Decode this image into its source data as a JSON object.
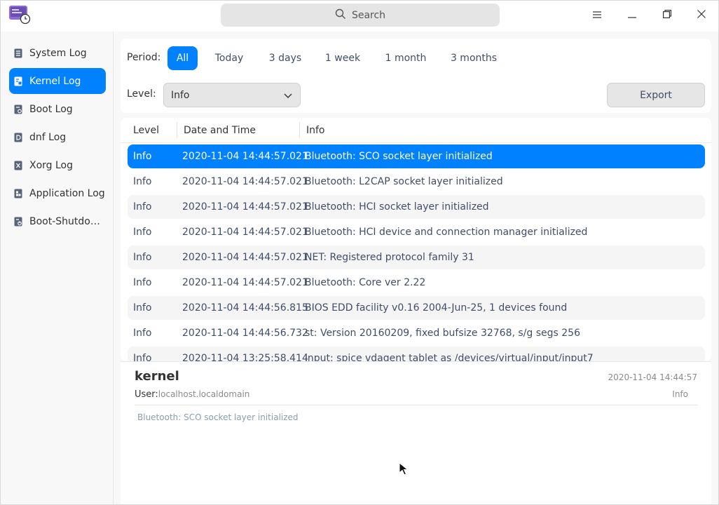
{
  "search": {
    "placeholder": "Search"
  },
  "sidebar": {
    "items": [
      {
        "label": "System Log"
      },
      {
        "label": "Kernel Log",
        "active": true
      },
      {
        "label": "Boot Log"
      },
      {
        "label": "dnf Log"
      },
      {
        "label": "Xorg Log"
      },
      {
        "label": "Application Log"
      },
      {
        "label": "Boot-Shutdown Event"
      }
    ]
  },
  "filters": {
    "period_label": "Period:",
    "periods": [
      "All",
      "Today",
      "3 days",
      "1 week",
      "1 month",
      "3 months"
    ],
    "selected_period": "All",
    "level_label": "Level:",
    "level_value": "Info",
    "export_label": "Export"
  },
  "table": {
    "columns": [
      "Level",
      "Date and Time",
      "Info"
    ],
    "rows": [
      {
        "level": "Info",
        "datetime": "2020-11-04 14:44:57.021",
        "info": "Bluetooth: SCO socket layer initialized"
      },
      {
        "level": "Info",
        "datetime": "2020-11-04 14:44:57.021",
        "info": "Bluetooth: L2CAP socket layer initialized"
      },
      {
        "level": "Info",
        "datetime": "2020-11-04 14:44:57.021",
        "info": "Bluetooth: HCI socket layer initialized"
      },
      {
        "level": "Info",
        "datetime": "2020-11-04 14:44:57.021",
        "info": "Bluetooth: HCI device and connection manager initialized"
      },
      {
        "level": "Info",
        "datetime": "2020-11-04 14:44:57.021",
        "info": "NET: Registered protocol family 31"
      },
      {
        "level": "Info",
        "datetime": "2020-11-04 14:44:57.021",
        "info": "Bluetooth: Core ver 2.22"
      },
      {
        "level": "Info",
        "datetime": "2020-11-04 14:44:56.815",
        "info": "BIOS EDD facility v0.16 2004-Jun-25, 1 devices found"
      },
      {
        "level": "Info",
        "datetime": "2020-11-04 14:44:56.732",
        "info": "st: Version 20160209, fixed bufsize 32768, s/g segs 256"
      },
      {
        "level": "Info",
        "datetime": "2020-11-04 13:25:58.414",
        "info": "input: spice vdagent tablet as /devices/virtual/input/input7"
      }
    ]
  },
  "detail": {
    "title": "kernel",
    "datetime": "2020-11-04 14:44:57",
    "user_label": "User:",
    "user_value": "localhost.localdomain",
    "level": "Info",
    "message": "Bluetooth: SCO socket layer initialized"
  },
  "colors": {
    "accent": "#0081ff",
    "alt_row": "#f5f5f5"
  }
}
